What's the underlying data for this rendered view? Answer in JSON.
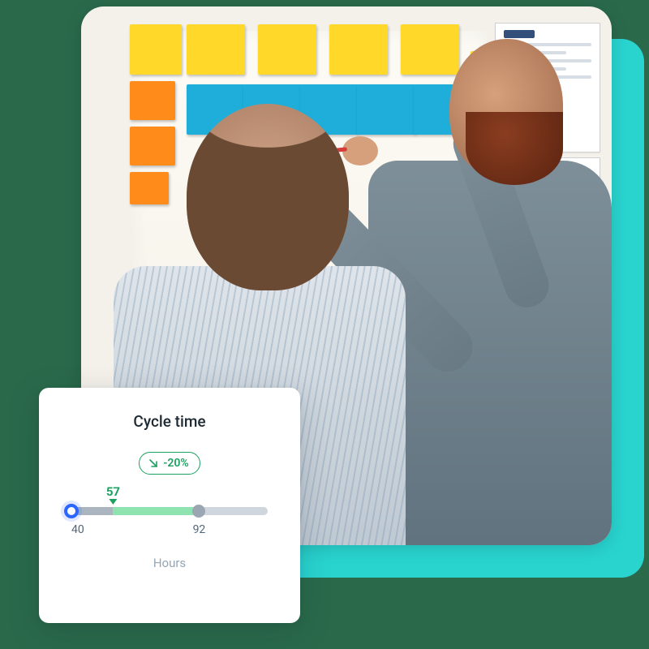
{
  "card": {
    "title": "Cycle time",
    "delta_label": "-20%",
    "delta_direction": "down",
    "value": 57,
    "range_min": 40,
    "range_max": 92,
    "track_visual_max": 120,
    "unit": "Hours"
  },
  "colors": {
    "teal": "#29d4cf",
    "green": "#1da160",
    "blue": "#2a66ff"
  },
  "photo_alt": "Two people looking at sticky notes and wireframe mockups on a whiteboard"
}
